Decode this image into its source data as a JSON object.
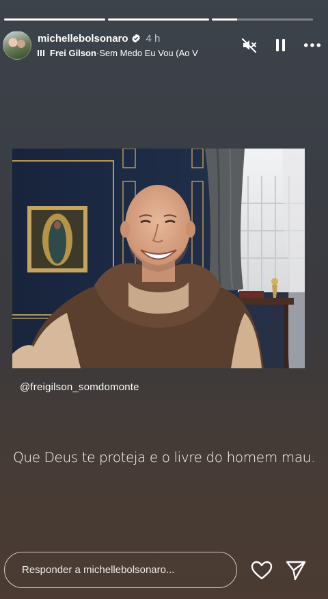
{
  "header": {
    "username": "michellebolsonaro",
    "time": "4 h",
    "music": {
      "artist": "Frei Gilson",
      "separator": " · ",
      "song": "Sem Medo Eu Vou (Ao V"
    }
  },
  "progress": [
    1.0,
    1.0,
    0.25
  ],
  "controls": {
    "mute_icon": "volume-muted-icon",
    "pause_icon": "pause-icon",
    "more_icon": "more-options-icon"
  },
  "mention": "@freigilson_somdomonte",
  "caption": "Que Deus te proteja e o livre do homem mau.",
  "reply": {
    "placeholder": "Responder a michellebolsonaro..."
  },
  "colors": {
    "verified_badge": "#ffffff",
    "wall": "#1c2a44",
    "habit": "#5b3f2e"
  }
}
